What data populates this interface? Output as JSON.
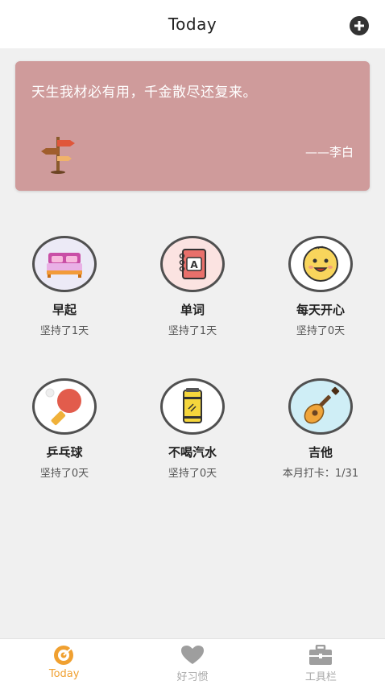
{
  "header": {
    "title": "Today"
  },
  "quote": {
    "text": "天生我材必有用，千金散尽还复来。",
    "author": "——李白"
  },
  "habits": [
    {
      "name": "早起",
      "status": "坚持了1天",
      "icon": "bed-icon"
    },
    {
      "name": "单词",
      "status": "坚持了1天",
      "icon": "notebook-icon"
    },
    {
      "name": "每天开心",
      "status": "坚持了0天",
      "icon": "smiley-icon"
    },
    {
      "name": "乒乓球",
      "status": "坚持了0天",
      "icon": "ping-pong-icon"
    },
    {
      "name": "不喝汽水",
      "status": "坚持了0天",
      "icon": "soda-can-icon"
    },
    {
      "name": "吉他",
      "status": "本月打卡：1/31",
      "icon": "guitar-icon"
    }
  ],
  "tabs": [
    {
      "label": "Today",
      "icon": "target-icon",
      "active": true
    },
    {
      "label": "好习惯",
      "icon": "heart-icon",
      "active": false
    },
    {
      "label": "工具栏",
      "icon": "toolbox-icon",
      "active": false
    }
  ],
  "colors": {
    "card": "#cf9b9b",
    "accent": "#f0a030",
    "inactive": "#a9a9a9"
  }
}
